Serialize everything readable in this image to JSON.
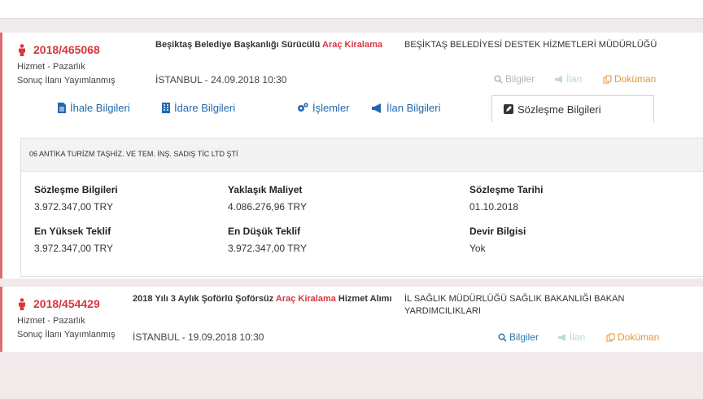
{
  "colors": {
    "accent_red": "#d9363e",
    "link_blue": "#2267ad",
    "doc_orange": "#e6953a",
    "disabled_green": "#b9dccd"
  },
  "cards": [
    {
      "ihale_no": "2018/465068",
      "type": "Hizmet - Pazarlık",
      "status": "Sonuç İlanı Yayımlanmış",
      "title_before": "Beşiktaş Belediye Başkanlığı Sürücülü ",
      "title_highlight": "Araç Kiralama",
      "title_after": "",
      "organization": "BEŞİKTAŞ BELEDİYESİ DESTEK HİZMETLERİ MÜDÜRLÜĞÜ",
      "place_date": "İSTANBUL - 24.09.2018 10:30",
      "actions": {
        "bilgiler": "Bilgiler",
        "ilan": "İlan",
        "dokuman": "Doküman"
      },
      "tabs": [
        "İhale Bilgileri",
        "İdare Bilgileri",
        "İşlemler",
        "İlan Bilgileri",
        "Sözleşme Bilgileri"
      ],
      "contract": {
        "firm": "06 ANTİKA TURİZM TAŞHİZ. VE TEM. İNŞ. SADIŞ TİC LTD ŞTİ",
        "fields": [
          {
            "label": "Sözleşme Bilgileri",
            "value": "3.972.347,00 TRY"
          },
          {
            "label": "Yaklaşık Maliyet",
            "value": "4.086.276,96 TRY"
          },
          {
            "label": "Sözleşme Tarihi",
            "value": "01.10.2018"
          },
          {
            "label": "En Yüksek Teklif",
            "value": "3.972.347,00 TRY"
          },
          {
            "label": "En Düşük Teklif",
            "value": "3.972.347,00 TRY"
          },
          {
            "label": "Devir Bilgisi",
            "value": "Yok"
          }
        ]
      }
    },
    {
      "ihale_no": "2018/454429",
      "type": "Hizmet - Pazarlık",
      "status": "Sonuç İlanı Yayımlanmış",
      "title_before": "2018 Yılı 3 Aylık Şoförlü Şoförsüz ",
      "title_highlight": "Araç Kiralama",
      "title_after": " Hizmet Alımı",
      "organization": "İL SAĞLIK MÜDÜRLÜĞÜ SAĞLIK BAKANLIĞI BAKAN YARDIMCILIKLARI",
      "place_date": "İSTANBUL - 19.09.2018 10:30",
      "actions": {
        "bilgiler": "Bilgiler",
        "ilan": "İlan",
        "dokuman": "Doküman"
      }
    }
  ]
}
